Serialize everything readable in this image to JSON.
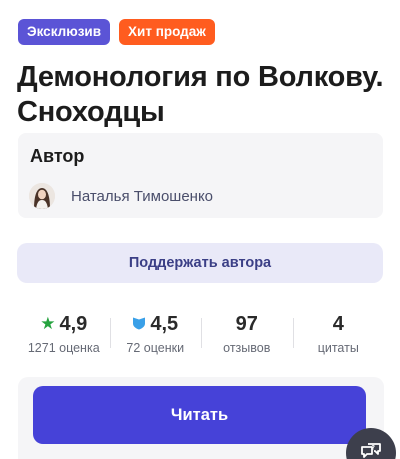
{
  "badges": {
    "exclusive": "Эксклюзив",
    "hit": "Хит продаж"
  },
  "book": {
    "title": "Демонология по Волкову. Сноходцы"
  },
  "author_section": {
    "heading": "Автор",
    "name": "Наталья Тимошенко"
  },
  "support_button": "Поддержать автора",
  "stats": {
    "rating": {
      "value": "4,9",
      "label": "1271 оценка",
      "icon": "star-icon",
      "color": "#26a33f"
    },
    "litres_rating": {
      "value": "4,5",
      "label": "72 оценки",
      "icon": "shield-icon",
      "color": "#3aa0e8"
    },
    "reviews": {
      "value": "97",
      "label": "отзывов"
    },
    "quotes": {
      "value": "4",
      "label": "цитаты"
    }
  },
  "read_button": "Читать",
  "chat_button": {
    "icon": "chat-help-icon"
  },
  "colors": {
    "accent": "#4642d8",
    "exclusive_badge": "#5b54d6",
    "hit_badge": "#ff5c1f"
  }
}
